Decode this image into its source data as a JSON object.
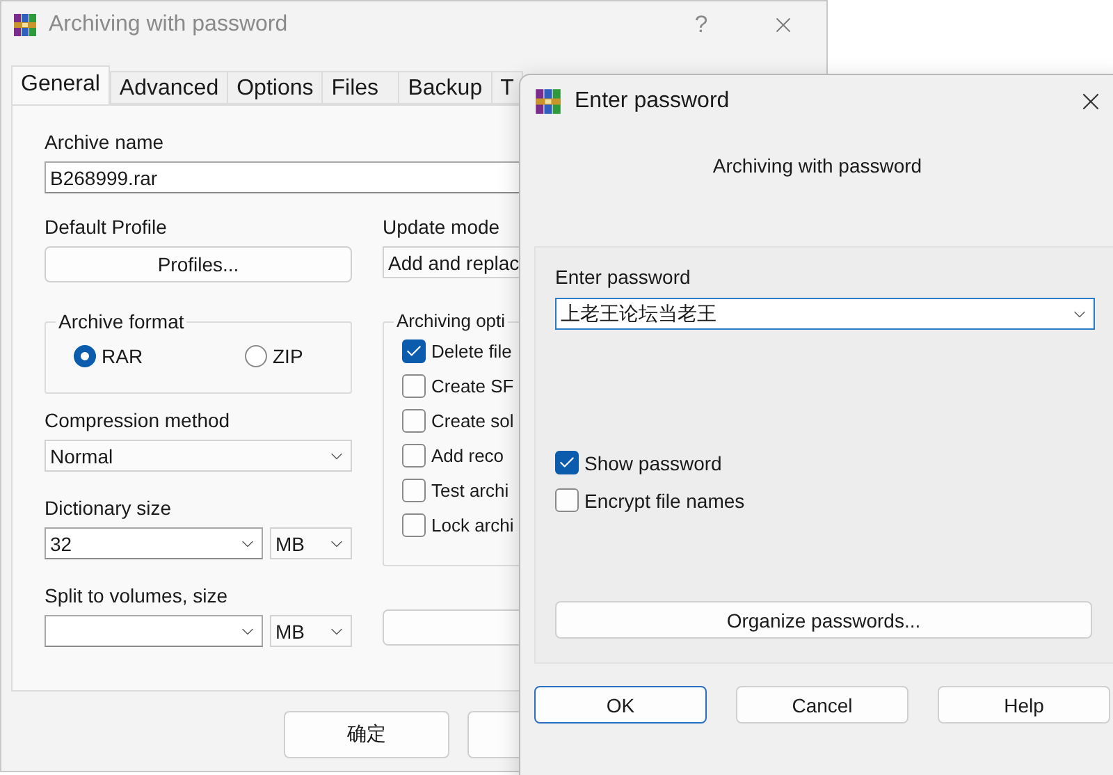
{
  "main_window": {
    "title": "Archiving with password",
    "help_glyph": "?",
    "tabs": [
      {
        "label": "General",
        "selected": true
      },
      {
        "label": "Advanced",
        "selected": false
      },
      {
        "label": "Options",
        "selected": false
      },
      {
        "label": "Files",
        "selected": false
      },
      {
        "label": "Backup",
        "selected": false
      },
      {
        "label": "T",
        "selected": false
      }
    ],
    "archive_name": {
      "label": "Archive name",
      "value": "B268999.rar"
    },
    "default_profile": {
      "label": "Default Profile",
      "button": "Profiles..."
    },
    "update_mode": {
      "label": "Update mode",
      "value": "Add and replac"
    },
    "archive_format": {
      "label": "Archive format",
      "options": [
        {
          "label": "RAR",
          "selected": true
        },
        {
          "label": "ZIP",
          "selected": false
        }
      ]
    },
    "archiving_options": {
      "label": "Archiving opti",
      "items": [
        {
          "label": "Delete file",
          "checked": true
        },
        {
          "label": "Create SF",
          "checked": false
        },
        {
          "label": "Create sol",
          "checked": false
        },
        {
          "label": "Add reco",
          "checked": false
        },
        {
          "label": "Test archi",
          "checked": false
        },
        {
          "label": "Lock archi",
          "checked": false
        }
      ]
    },
    "compression_method": {
      "label": "Compression method",
      "value": "Normal"
    },
    "dictionary_size": {
      "label": "Dictionary size",
      "value": "32",
      "unit": "MB"
    },
    "split_volumes": {
      "label": "Split to volumes, size",
      "unit": "MB"
    },
    "buttons": [
      "确定"
    ]
  },
  "password_dialog": {
    "title": "Enter password",
    "subtitle": "Archiving with password",
    "password": {
      "label": "Enter password",
      "value": "上老王论坛当老王"
    },
    "options": [
      {
        "label": "Show password",
        "checked": true
      },
      {
        "label": "Encrypt file names",
        "checked": false
      }
    ],
    "organize_button": "Organize passwords...",
    "buttons": [
      {
        "label": "OK",
        "selected": true
      },
      {
        "label": "Cancel",
        "selected": false
      },
      {
        "label": "Help",
        "selected": false
      }
    ]
  }
}
